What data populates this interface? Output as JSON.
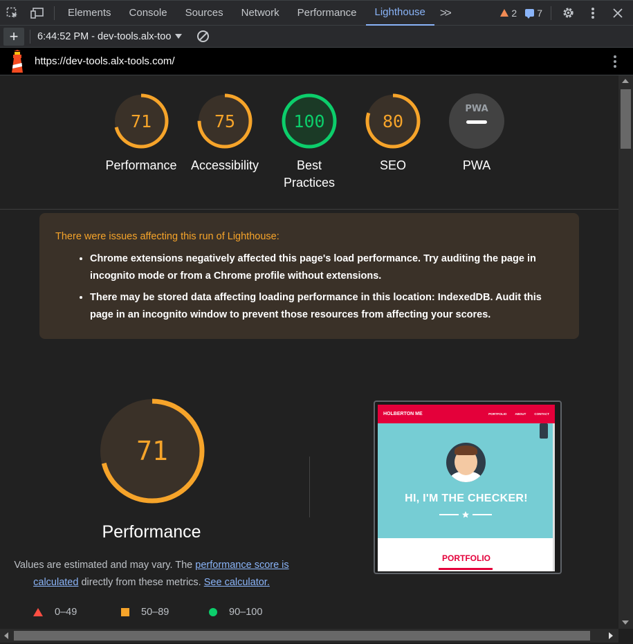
{
  "devtools": {
    "tabs": [
      "Elements",
      "Console",
      "Sources",
      "Network",
      "Performance",
      "Lighthouse"
    ],
    "active_tab": "Lighthouse",
    "warnings_count": "2",
    "messages_count": "7"
  },
  "lighthouse_toolbar": {
    "report_label": "6:44:52 PM - dev-tools.alx-too"
  },
  "url_bar": {
    "url": "https://dev-tools.alx-tools.com/"
  },
  "scores": [
    {
      "value": "71",
      "label": "Performance",
      "fraction": 0.71,
      "color": "#f6a42a"
    },
    {
      "value": "75",
      "label": "Accessibility",
      "fraction": 0.75,
      "color": "#f6a42a"
    },
    {
      "value": "100",
      "label": "Best Practices",
      "fraction": 1.0,
      "color": "#0cce6b"
    },
    {
      "value": "80",
      "label": "SEO",
      "fraction": 0.8,
      "color": "#f6a42a"
    },
    {
      "value": "PWA",
      "label": "PWA",
      "fraction": 0,
      "color": "#9aa0a6"
    }
  ],
  "score_labels": {
    "best_1": "Best",
    "best_2": "Practices"
  },
  "issues": {
    "title": "There were issues affecting this run of Lighthouse:",
    "items": [
      "Chrome extensions negatively affected this page's load performance. Try auditing the page in incognito mode or from a Chrome profile without extensions.",
      "There may be stored data affecting loading performance in this location: IndexedDB. Audit this page in an incognito window to prevent those resources from affecting your scores."
    ]
  },
  "performance": {
    "score": "71",
    "fraction": 0.71,
    "title": "Performance",
    "desc_pre": "Values are estimated and may vary. The ",
    "desc_link1": "performance score is calculated",
    "desc_mid": " directly from these metrics. ",
    "desc_link2": "See calculator."
  },
  "legend": [
    {
      "range": "0–49",
      "shape": "triangle",
      "color": "#ff4e42"
    },
    {
      "range": "50–89",
      "shape": "square",
      "color": "#f6a42a"
    },
    {
      "range": "90–100",
      "shape": "circle",
      "color": "#0cce6b"
    }
  ],
  "screenshot": {
    "brand": "HOLBERTON ME",
    "nav_links": [
      "PORTFOLIO",
      "ABOUT",
      "CONTACT"
    ],
    "hero_text": "HI, I'M THE CHECKER!",
    "section_title": "PORTFOLIO"
  }
}
